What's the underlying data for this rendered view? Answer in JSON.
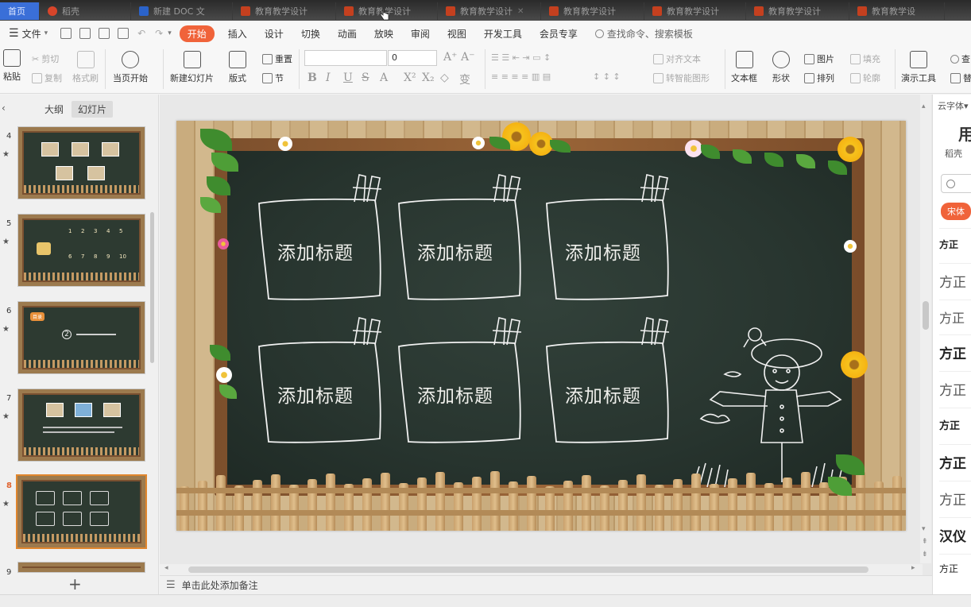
{
  "tabs": [
    {
      "label": "首页",
      "type": "home"
    },
    {
      "label": "稻壳",
      "type": "wps"
    },
    {
      "label": "新建 DOC 文",
      "type": "doc"
    },
    {
      "label": "教育教学设计",
      "type": "ppt"
    },
    {
      "label": "教育教学设计",
      "type": "ppt"
    },
    {
      "label": "教育教学设计",
      "type": "ppt"
    },
    {
      "label": "教育教学设计",
      "type": "ppt"
    },
    {
      "label": "教育教学设计",
      "type": "ppt"
    },
    {
      "label": "教育教学设计",
      "type": "ppt"
    },
    {
      "label": "教育教学设",
      "type": "ppt"
    }
  ],
  "menu": {
    "file": "文件",
    "items": [
      "开始",
      "插入",
      "设计",
      "切换",
      "动画",
      "放映",
      "审阅",
      "视图",
      "开发工具",
      "会员专享"
    ],
    "active": "开始",
    "search": "查找命令、搜索模板"
  },
  "ribbon": {
    "paste": "粘贴",
    "cut": "剪切",
    "copy": "复制",
    "format_painter": "格式刷",
    "play_from_current": "当页开始",
    "new_slide": "新建幻灯片",
    "layout": "版式",
    "reset": "重置",
    "section": "节",
    "font_size": "0",
    "align_text": "对齐文本",
    "smartart": "转智能图形",
    "textbox": "文本框",
    "shape": "形状",
    "picture": "图片",
    "arrange": "排列",
    "fill": "填充",
    "outline": "轮廓",
    "presenter_tools": "演示工具",
    "find": "查",
    "replace": "替"
  },
  "left_panel": {
    "tab_outline": "大纲",
    "tab_slides": "幻灯片",
    "slide_numbers": [
      "4",
      "5",
      "6",
      "7",
      "8",
      "9"
    ],
    "selected": "8",
    "thumb6_badge": "目录",
    "thumb6_num": "2",
    "thumb5_numbers": [
      "1",
      "2",
      "3",
      "4",
      "5",
      "6",
      "7",
      "8",
      "9",
      "10"
    ]
  },
  "slide": {
    "cards": [
      "添加标题",
      "添加标题",
      "添加标题",
      "添加标题",
      "添加标题",
      "添加标题"
    ]
  },
  "right_panel": {
    "header": "云字体",
    "title": "用",
    "subtitle": "稻壳",
    "font_tag": "宋体",
    "fonts": [
      "方正",
      "方正",
      "方正",
      "方正",
      "方正",
      "方正",
      "方正",
      "方正",
      "汉仪",
      "方正"
    ]
  },
  "notes": {
    "placeholder": "单击此处添加备注"
  }
}
